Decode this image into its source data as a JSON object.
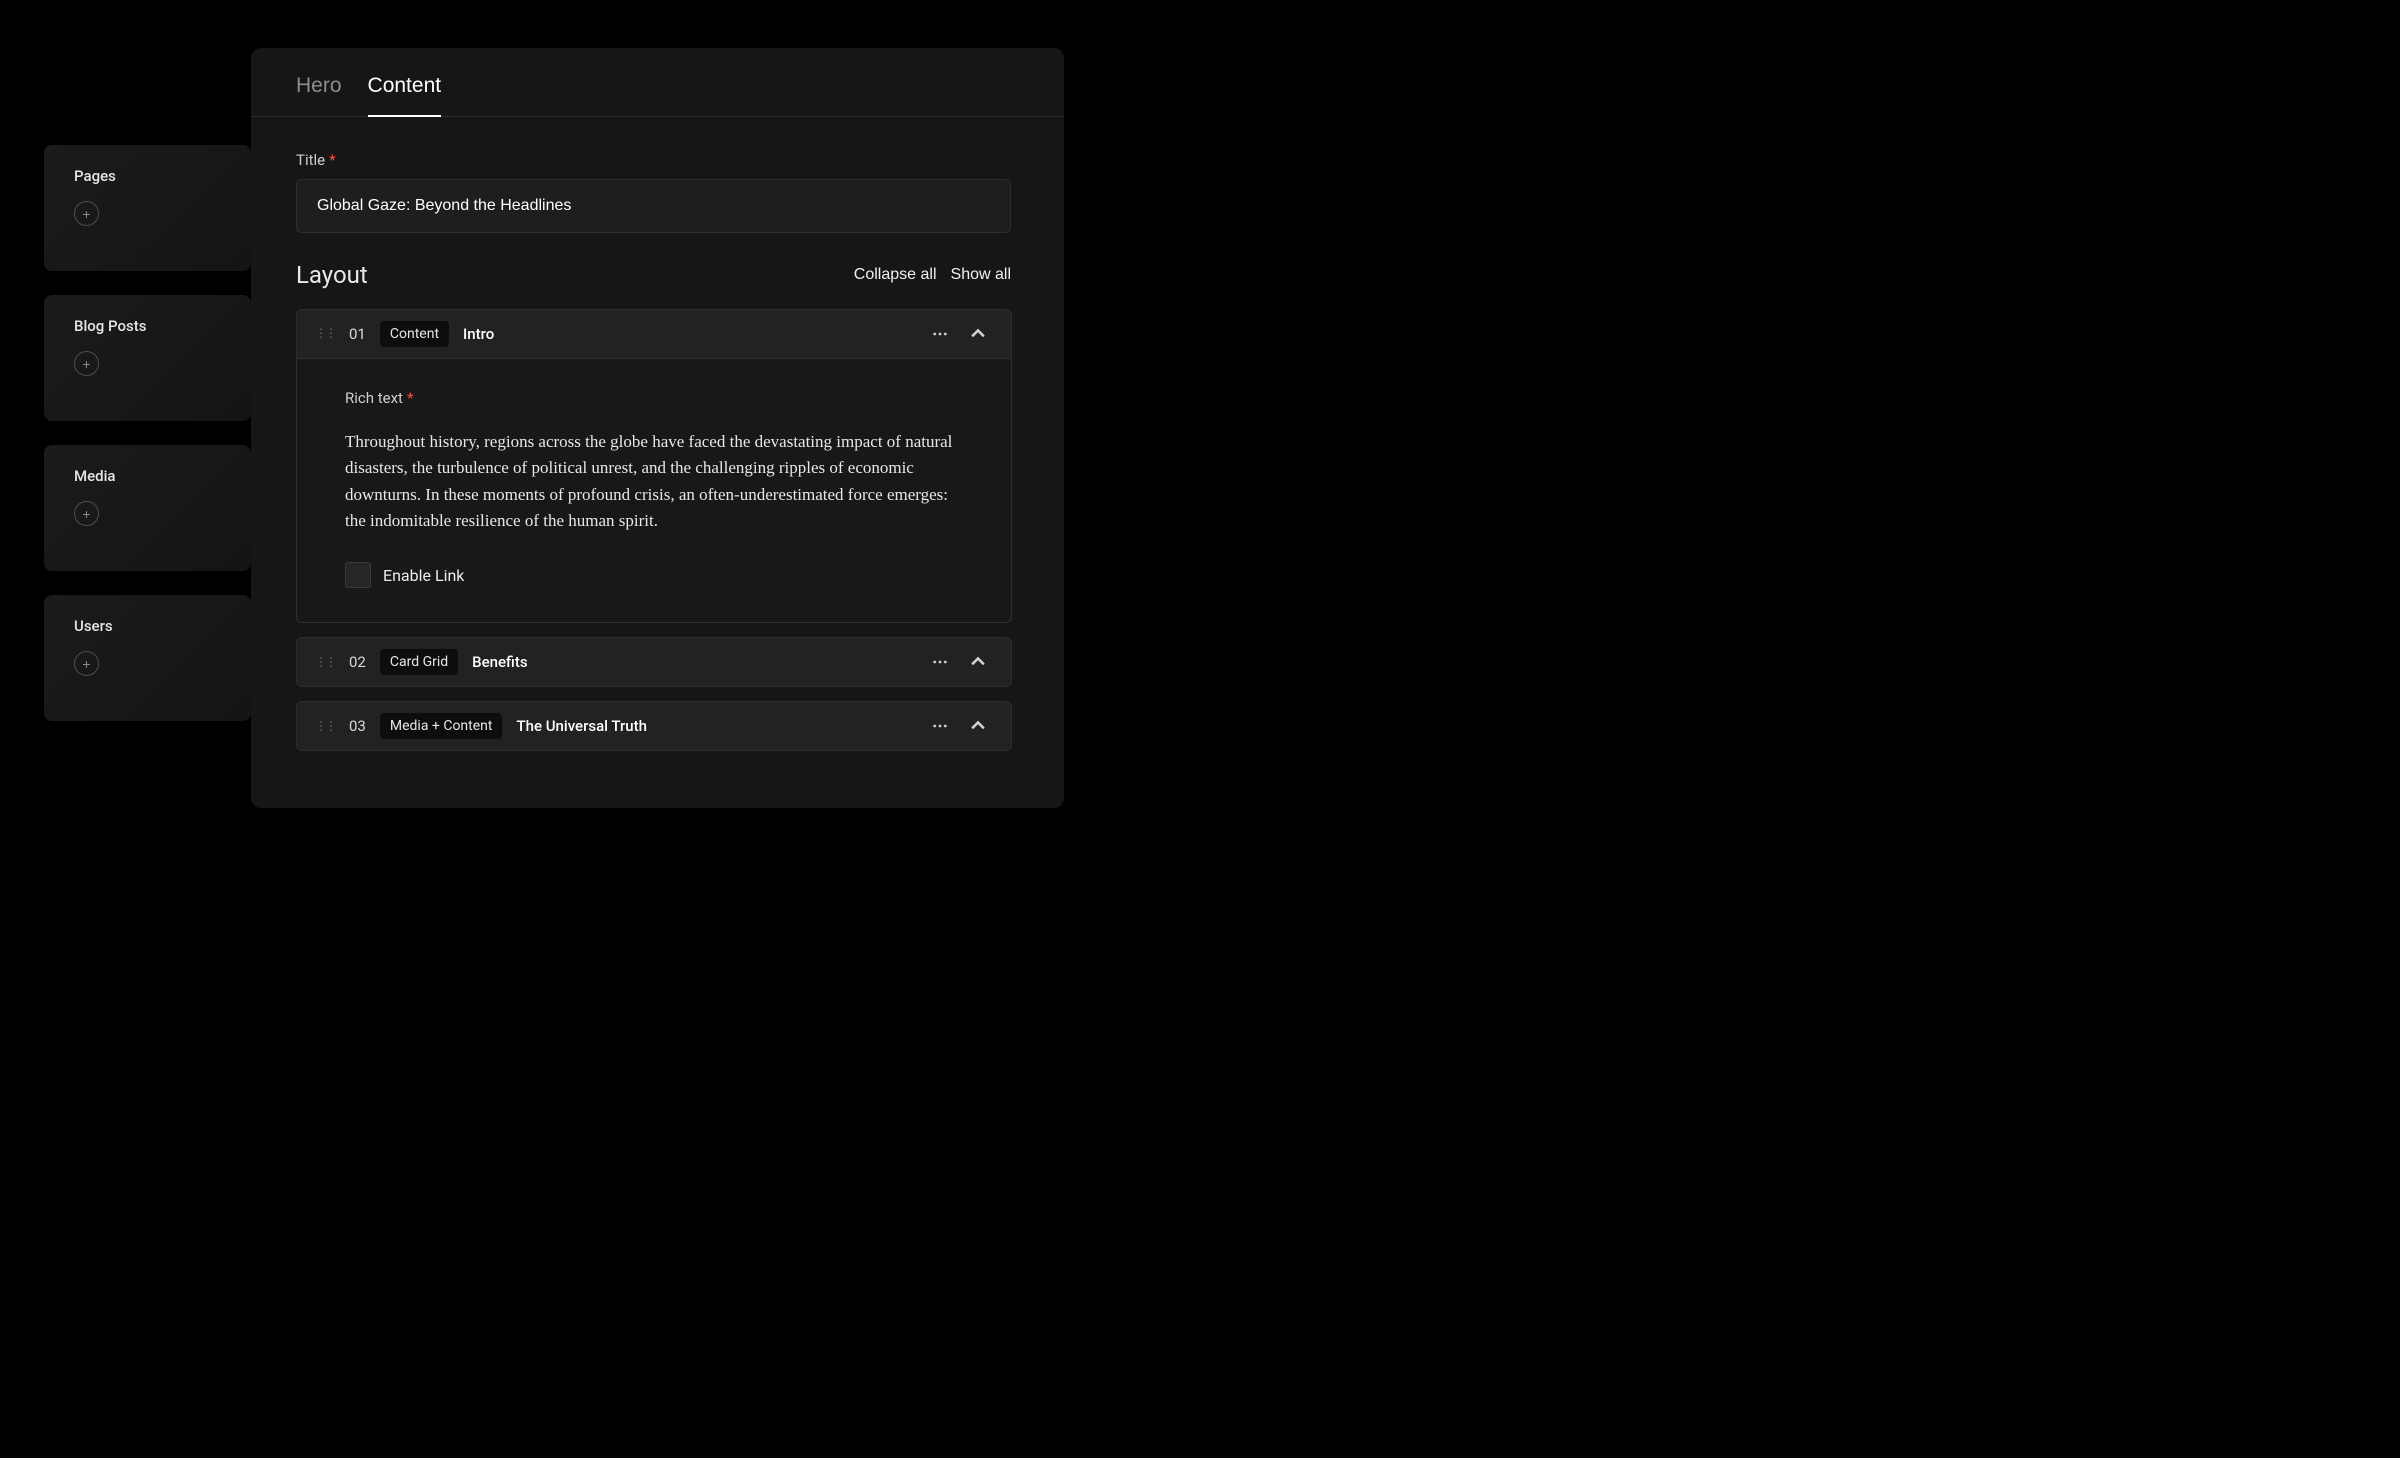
{
  "sidebar": {
    "items": [
      {
        "title": "Pages"
      },
      {
        "title": "Blog Posts"
      },
      {
        "title": "Media"
      },
      {
        "title": "Users"
      }
    ]
  },
  "tabs": [
    {
      "label": "Hero",
      "active": false
    },
    {
      "label": "Content",
      "active": true
    }
  ],
  "title_field": {
    "label": "Title",
    "value": "Global Gaze: Beyond the Headlines"
  },
  "layout": {
    "heading": "Layout",
    "collapse_all": "Collapse all",
    "show_all": "Show all"
  },
  "blocks": [
    {
      "num": "01",
      "type": "Content",
      "title": "Intro",
      "expanded": true,
      "rich_text_label": "Rich text",
      "rich_text_content": "Throughout history, regions across the globe have faced the devastating impact of natural disasters, the turbulence of political unrest, and the challenging ripples of economic downturns. In these moments of profound crisis, an often-underestimated force emerges: the indomitable resilience of the human spirit.",
      "enable_link_label": "Enable Link"
    },
    {
      "num": "02",
      "type": "Card Grid",
      "title": "Benefits",
      "expanded": false
    },
    {
      "num": "03",
      "type": "Media + Content",
      "title": "The Universal Truth",
      "expanded": false
    }
  ]
}
